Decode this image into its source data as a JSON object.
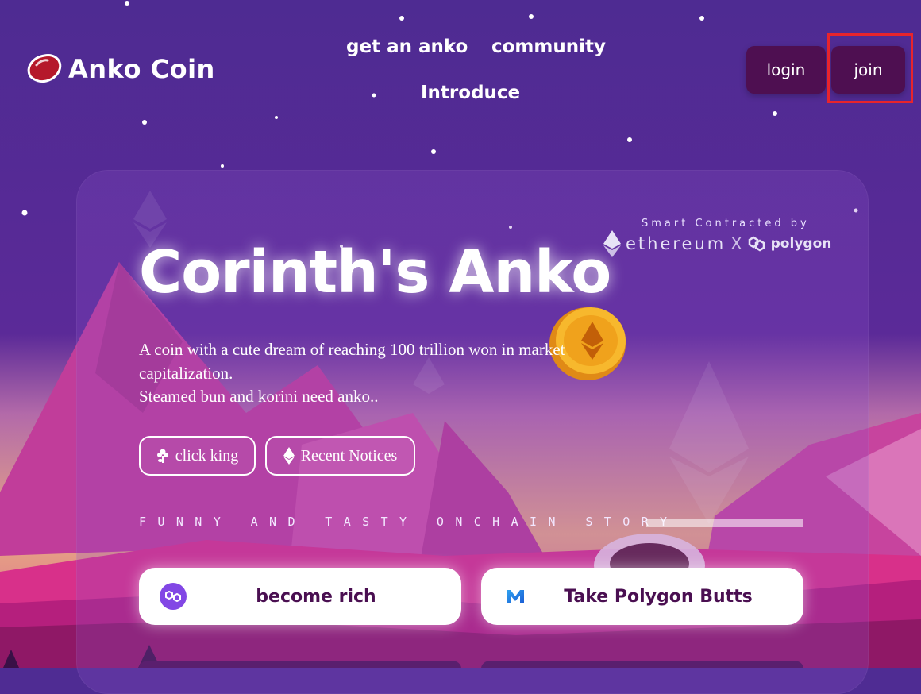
{
  "brand": {
    "name": "Anko Coin",
    "logo_icon": "red-bean-icon"
  },
  "nav": {
    "links": [
      "get an anko",
      "community",
      "Introduce"
    ],
    "login_label": "login",
    "join_label": "join"
  },
  "hero": {
    "smart_contract_label": "Smart Contracted by",
    "ethereum_label": "ethereum",
    "x_label": "X",
    "polygon_label": "polygon",
    "title": "Corinth's Anko",
    "description_line1": "A coin with a cute dream of reaching 100 trillion won in market capitalization.",
    "description_line2": "Steamed bun and korini need anko..",
    "buttons": [
      {
        "label": "click king",
        "icon": "flower-icon"
      },
      {
        "label": "Recent Notices",
        "icon": "ethereum-icon"
      }
    ],
    "tagline": "FUNNY AND TASTY ONCHAIN STORY"
  },
  "actions": [
    {
      "label": "become rich",
      "icon": "polygon-icon"
    },
    {
      "label": "Take Polygon Butts",
      "icon": "polygon-m-icon"
    }
  ],
  "colors": {
    "bg_top": "#4f2c93",
    "button_dark": "#4e0f51",
    "highlight": "#e8242c",
    "mountain_pink": "#c13d9a"
  }
}
